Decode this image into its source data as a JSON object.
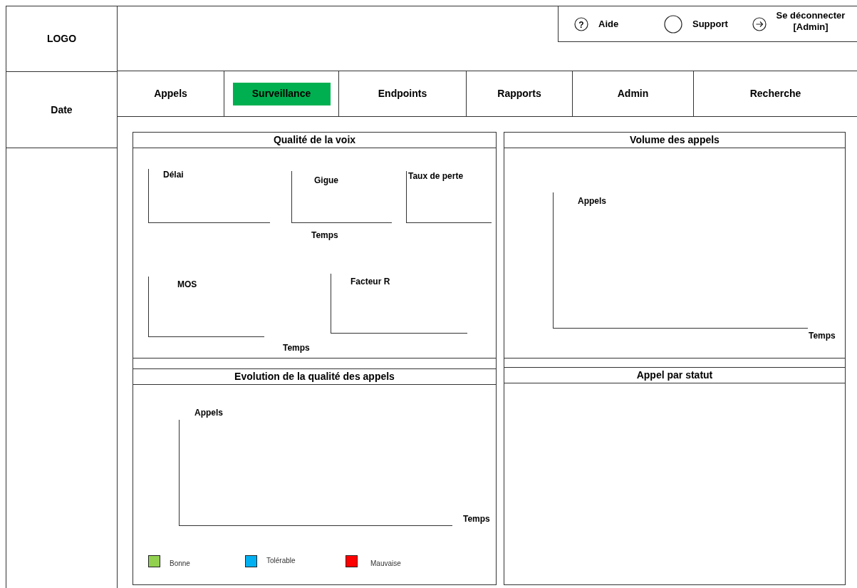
{
  "logo": "LOGO",
  "date": "Date",
  "header_links": [
    {
      "kind": "help",
      "icon_text": "?",
      "label": "Aide"
    },
    {
      "kind": "support",
      "label": "Support"
    },
    {
      "kind": "logout",
      "label": "Se déconnecter [Admin]"
    }
  ],
  "tabs": [
    {
      "label": "Appels",
      "selected": false
    },
    {
      "label": "Surveillance",
      "selected": true
    },
    {
      "label": "Endpoints",
      "selected": false
    },
    {
      "label": "Rapports",
      "selected": false
    },
    {
      "label": "Admin",
      "selected": false
    },
    {
      "label": "Recherche",
      "selected": false
    }
  ],
  "voice_quality": {
    "title": "Qualité de la voix",
    "charts": [
      {
        "ylabel": "Délai"
      },
      {
        "ylabel": "Gigue"
      },
      {
        "ylabel": "Taux de perte"
      },
      {
        "ylabel": "MOS"
      },
      {
        "ylabel": "Facteur R"
      }
    ],
    "xlabels": [
      "Temps",
      "Temps"
    ]
  },
  "call_volume": {
    "title": "Volume des appels",
    "ylabel": "Appels",
    "xlabel": "Temps"
  },
  "quality_trend": {
    "title": "Evolution de la qualité des appels",
    "ylabel": "Appels",
    "xlabel": "Temps",
    "legend": [
      {
        "label": "Bonne",
        "color": "#92d050"
      },
      {
        "label": "Tolérable",
        "color": "#00b0f0"
      },
      {
        "label": "Mauvaise",
        "color": "#ff0000"
      }
    ]
  },
  "calls_by_status": {
    "title": "Appel par statut"
  }
}
